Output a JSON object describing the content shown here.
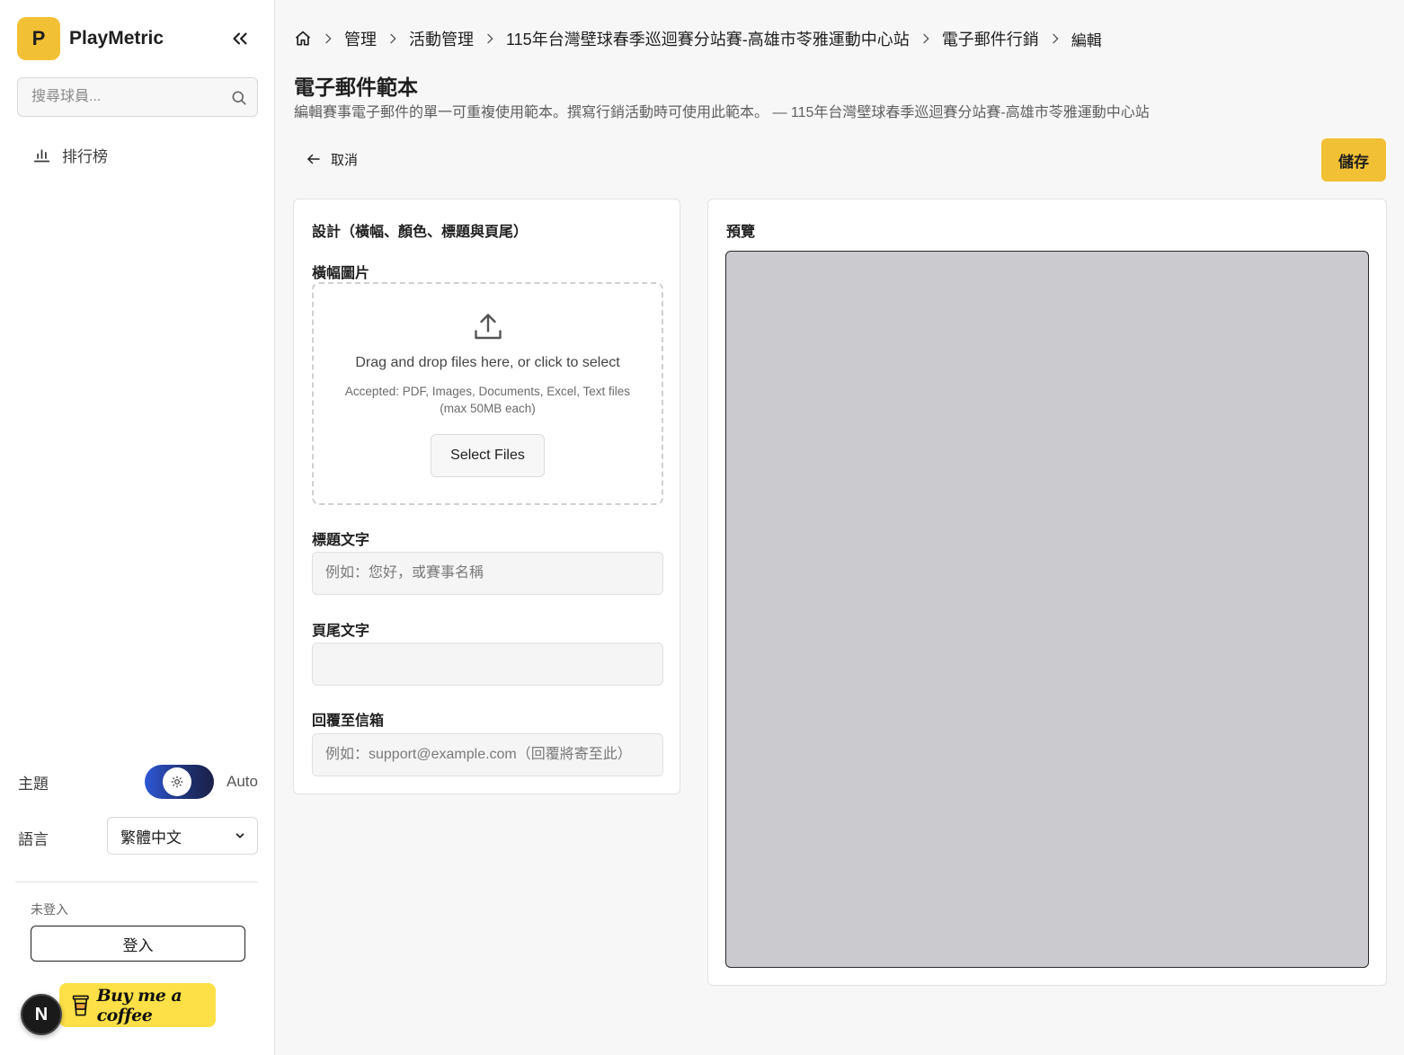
{
  "sidebar": {
    "logo_letter": "P",
    "brand_name": "PlayMetric",
    "search_placeholder": "搜尋球員...",
    "nav_items": [
      {
        "label": "排行榜",
        "icon": "bar-chart-icon"
      }
    ],
    "theme_label": "主題",
    "theme_mode": "Auto",
    "language_label": "語言",
    "language_value": "繁體中文",
    "login_status": "未登入",
    "login_button": "登入",
    "next_badge": "N",
    "coffee_label": "Buy me a coffee"
  },
  "breadcrumb": {
    "items": [
      "管理",
      "活動管理",
      "115年台灣壁球春季巡迴賽分站賽-高雄市苓雅運動中心站",
      "電子郵件行銷"
    ],
    "current": "編輯"
  },
  "page": {
    "title": "電子郵件範本",
    "description": "編輯賽事電子郵件的單一可重複使用範本。撰寫行銷活動時可使用此範本。 — 115年台灣壁球春季巡迴賽分站賽-高雄市苓雅運動中心站",
    "cancel_label": "取消",
    "save_label": "儲存"
  },
  "design": {
    "title": "設計（橫幅、顏色、標題與頁尾）",
    "banner_label": "橫幅圖片",
    "dropzone_title": "Drag and drop files here, or click to select",
    "dropzone_subtitle": "Accepted: PDF, Images, Documents, Excel, Text files (max 50MB each)",
    "select_files": "Select Files",
    "heading_label": "標題文字",
    "heading_placeholder": "例如：您好，或賽事名稱",
    "heading_value": "",
    "footer_label": "頁尾文字",
    "footer_value": "",
    "reply_label": "回覆至信箱",
    "reply_placeholder": "例如：support@example.com（回覆將寄至此）",
    "reply_value": ""
  },
  "preview": {
    "title": "預覽"
  },
  "colors": {
    "accent": "#f2c035",
    "coffee": "#fde047",
    "preview_bg": "#cbcbcf"
  }
}
